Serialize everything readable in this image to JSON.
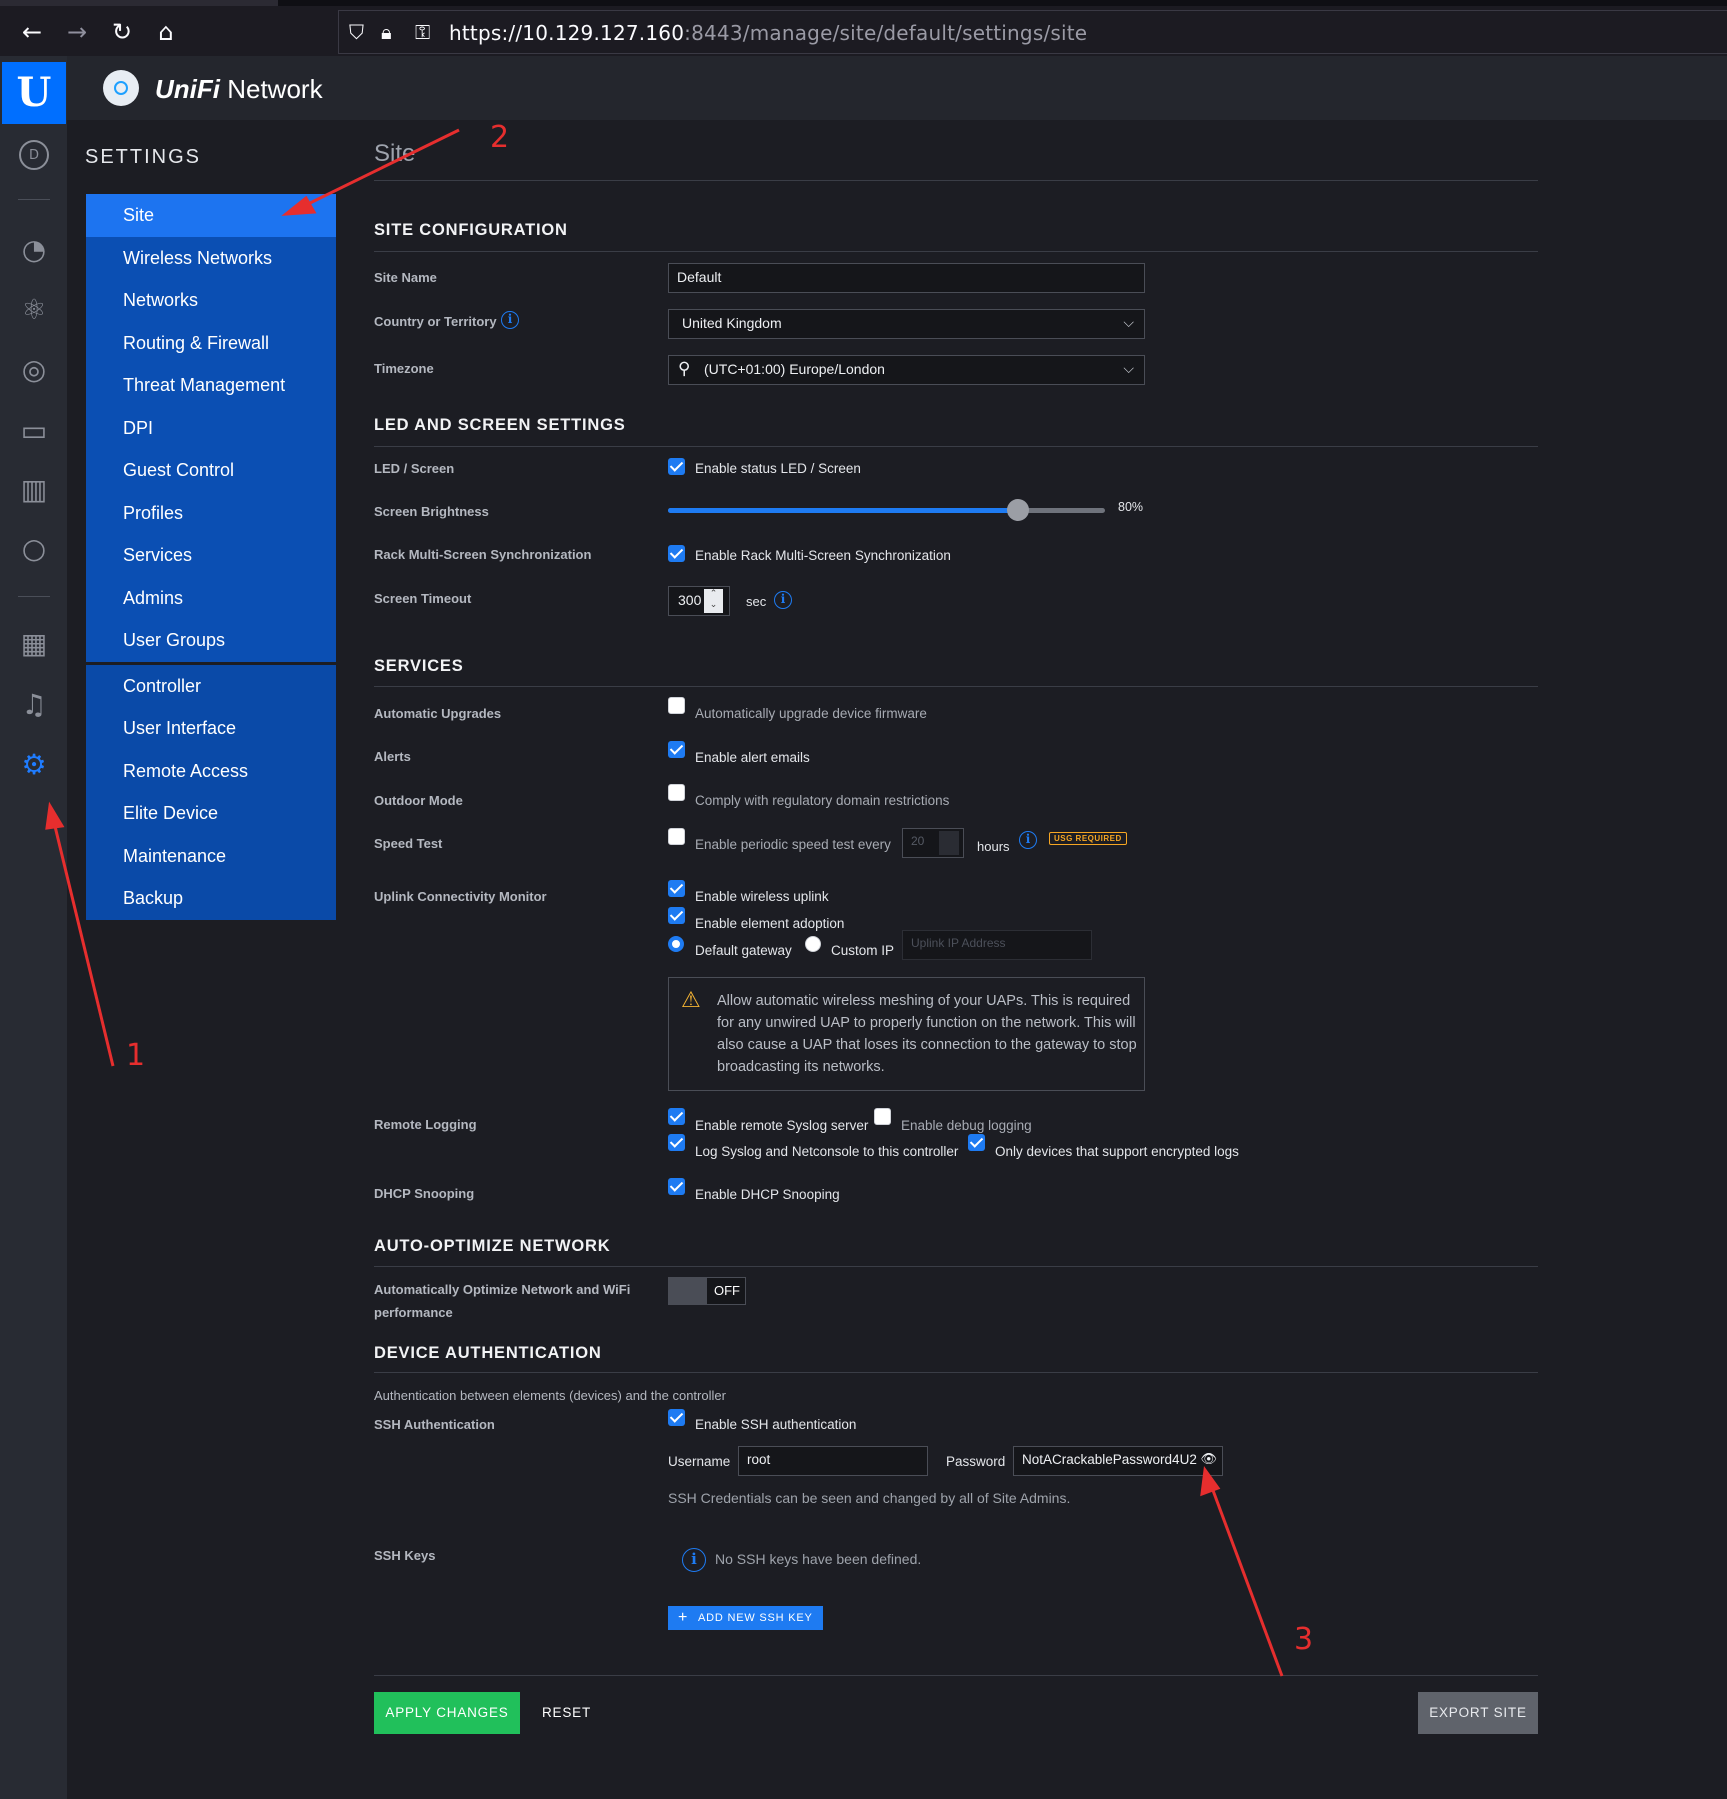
{
  "browser": {
    "url_host": "https://10.129.127.160",
    "url_rest": ":8443/manage/site/default/settings/site",
    "back_icon": "←",
    "forward_icon": "→",
    "reload_icon": "↻",
    "home_icon": "⌂"
  },
  "app": {
    "brand_u": "U",
    "title_bold": "UniFi",
    "title_rest": " Network"
  },
  "rail": {
    "dashboard_letter": "D",
    "icons": [
      "dashboard-icon",
      "statistics-icon",
      "topology-icon",
      "devices-icon",
      "clients-icon",
      "statistics-bars-icon",
      "insights-icon",
      "events-icon",
      "alerts-icon",
      "settings-icon"
    ]
  },
  "settings": {
    "title": "SETTINGS",
    "nav_primary": [
      "Site",
      "Wireless Networks",
      "Networks",
      "Routing & Firewall",
      "Threat Management",
      "DPI",
      "Guest Control",
      "Profiles",
      "Services",
      "Admins",
      "User Groups"
    ],
    "nav_secondary": [
      "Controller",
      "User Interface",
      "Remote Access",
      "Elite Device",
      "Maintenance",
      "Backup"
    ]
  },
  "page": {
    "title": "Site",
    "site_config": {
      "heading": "SITE CONFIGURATION",
      "site_name_label": "Site Name",
      "site_name_value": "Default",
      "country_label": "Country or Territory",
      "country_value": "United Kingdom",
      "timezone_label": "Timezone",
      "timezone_value": "(UTC+01:00) Europe/London"
    },
    "led": {
      "heading": "LED AND SCREEN SETTINGS",
      "led_label": "LED / Screen",
      "led_text": "Enable status LED / Screen",
      "brightness_label": "Screen Brightness",
      "brightness_value": "80%",
      "brightness_fraction": 0.8,
      "rack_label": "Rack Multi-Screen Synchronization",
      "rack_text": "Enable Rack Multi-Screen Synchronization",
      "timeout_label": "Screen Timeout",
      "timeout_value": "300",
      "timeout_unit": "sec"
    },
    "services": {
      "heading": "SERVICES",
      "auto_upgrades_label": "Automatic Upgrades",
      "auto_upgrades_text": "Automatically upgrade device firmware",
      "alerts_label": "Alerts",
      "alerts_text": "Enable alert emails",
      "outdoor_label": "Outdoor Mode",
      "outdoor_text": "Comply with regulatory domain restrictions",
      "speed_label": "Speed Test",
      "speed_text": "Enable periodic speed test every",
      "speed_hours": "20",
      "speed_unit": "hours",
      "usg_badge": "USG REQUIRED",
      "uplink_label": "Uplink Connectivity Monitor",
      "uplink_wireless": "Enable wireless uplink",
      "uplink_adoption": "Enable element adoption",
      "radio_gateway": "Default gateway",
      "radio_custom": "Custom IP",
      "uplink_ip_placeholder": "Uplink IP Address",
      "warning": "Allow automatic wireless meshing of your UAPs. This is required for any unwired UAP to properly function on the network. This will also cause a UAP that loses its connection to the gateway to stop broadcasting its networks.",
      "remote_logging_label": "Remote Logging",
      "syslog_text": "Enable remote Syslog server",
      "debug_text": "Enable debug logging",
      "netconsole_text": "Log Syslog and Netconsole to this controller",
      "encrypted_text": "Only devices that support encrypted logs",
      "dhcp_label": "DHCP Snooping",
      "dhcp_text": "Enable DHCP Snooping"
    },
    "auto_optimize": {
      "heading": "AUTO-OPTIMIZE NETWORK",
      "label_line1": "Automatically Optimize Network and WiFi",
      "label_line2": "performance",
      "toggle": "OFF"
    },
    "device_auth": {
      "heading": "DEVICE AUTHENTICATION",
      "subtitle": "Authentication between elements (devices) and the controller",
      "ssh_label": "SSH Authentication",
      "ssh_text": "Enable SSH authentication",
      "username_label": "Username",
      "username_value": "root",
      "password_label": "Password",
      "password_value": "NotACrackablePassword4U2",
      "credentials_note": "SSH Credentials can be seen and changed by all of Site Admins.",
      "ssh_keys_label": "SSH Keys",
      "no_keys_text": "No SSH keys have been defined.",
      "add_key_button": "ADD NEW SSH KEY"
    },
    "footer": {
      "apply": "APPLY CHANGES",
      "reset": "RESET",
      "export": "EXPORT SITE"
    }
  },
  "annotations": {
    "one": "1",
    "two": "2",
    "three": "3",
    "color": "#e62e2e"
  }
}
